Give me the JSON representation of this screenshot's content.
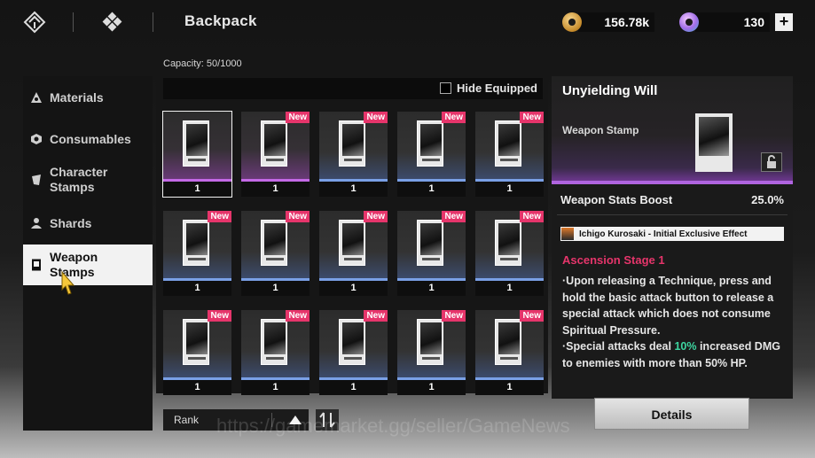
{
  "header": {
    "title": "Backpack",
    "currency_gold": "156.78k",
    "currency_gem": "130",
    "plus_label": "+",
    "icons": [
      "menu-diamond-icon",
      "grid-diamond-icon",
      "gold-coin-icon",
      "gem-icon",
      "plus-icon"
    ]
  },
  "capacity": "Capacity: 50/1000",
  "nav": {
    "items": [
      {
        "label": "Materials",
        "icon": "materials-icon"
      },
      {
        "label": "Consumables",
        "icon": "consumables-icon"
      },
      {
        "label": "Character Stamps",
        "icon": "character-stamp-icon"
      },
      {
        "label": "Shards",
        "icon": "shard-icon"
      },
      {
        "label": "Weapon Stamps",
        "icon": "weapon-stamp-icon",
        "active": true
      }
    ]
  },
  "filter": {
    "hide_equipped_label": "Hide Equipped",
    "hide_equipped_checked": false
  },
  "grid": {
    "new_badge": "New",
    "items": [
      {
        "count": "1",
        "new": false,
        "rarity": "rare",
        "selected": true
      },
      {
        "count": "1",
        "new": true,
        "rarity": "rare"
      },
      {
        "count": "1",
        "new": true,
        "rarity": "common"
      },
      {
        "count": "1",
        "new": true,
        "rarity": "common"
      },
      {
        "count": "1",
        "new": true,
        "rarity": "common"
      },
      {
        "count": "1",
        "new": true,
        "rarity": "common"
      },
      {
        "count": "1",
        "new": true,
        "rarity": "common"
      },
      {
        "count": "1",
        "new": true,
        "rarity": "common"
      },
      {
        "count": "1",
        "new": true,
        "rarity": "common"
      },
      {
        "count": "1",
        "new": true,
        "rarity": "common"
      },
      {
        "count": "1",
        "new": true,
        "rarity": "common"
      },
      {
        "count": "1",
        "new": true,
        "rarity": "common"
      },
      {
        "count": "1",
        "new": true,
        "rarity": "common"
      },
      {
        "count": "1",
        "new": true,
        "rarity": "common"
      },
      {
        "count": "1",
        "new": true,
        "rarity": "common"
      }
    ]
  },
  "sort": {
    "label": "Rank",
    "direction": "ascending"
  },
  "detail": {
    "name": "Unyielding Will",
    "type": "Weapon Stamp",
    "stat_label": "Weapon Stats Boost",
    "stat_value": "25.0%",
    "exclusive": "Ichigo Kurosaki - Initial Exclusive Effect",
    "stage": "Ascension Stage 1",
    "desc_line1": "·Upon releasing a Technique, press and hold the basic attack button to release a special attack which does not consume Spiritual Pressure.",
    "desc_line2_pre": "·Special attacks deal ",
    "desc_line2_hl": "10%",
    "desc_line2_post": " increased DMG to enemies with more than 50% HP.",
    "details_button": "Details"
  },
  "watermark": "https://gamemarket.gg/seller/GameNews",
  "colors": {
    "accent_pink": "#e6356b",
    "rare_purple": "#c469e6",
    "common_blue": "#7aa0e6",
    "highlight_green": "#3dd6a0"
  }
}
